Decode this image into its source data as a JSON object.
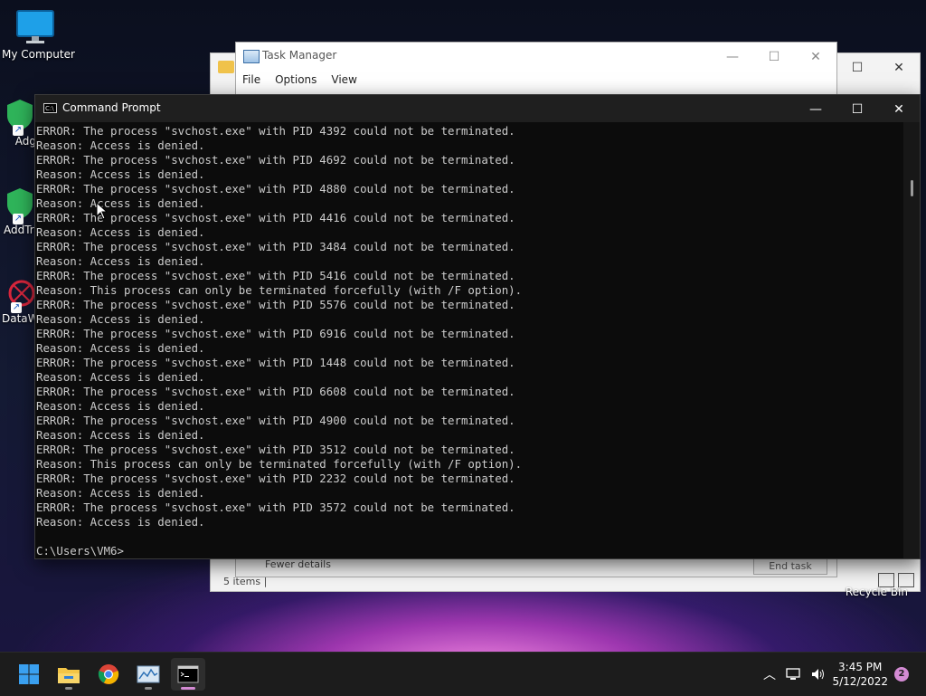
{
  "desktop": {
    "icons": [
      {
        "label": "My Computer"
      },
      {
        "label": "Adg"
      },
      {
        "label": "AddTri"
      },
      {
        "label": "DataW"
      }
    ],
    "recycle_bin": "Recycle Bin"
  },
  "explorer": {
    "status": "5 items  |"
  },
  "task_manager": {
    "title": "Task Manager",
    "menu": [
      "File",
      "Options",
      "View"
    ],
    "footer_left": "Fewer details",
    "footer_right": "End task"
  },
  "cmd": {
    "title": "Command Prompt",
    "lines": [
      "ERROR: The process \"svchost.exe\" with PID 4392 could not be terminated.",
      "Reason: Access is denied.",
      "ERROR: The process \"svchost.exe\" with PID 4692 could not be terminated.",
      "Reason: Access is denied.",
      "ERROR: The process \"svchost.exe\" with PID 4880 could not be terminated.",
      "Reason: Access is denied.",
      "ERROR: The process \"svchost.exe\" with PID 4416 could not be terminated.",
      "Reason: Access is denied.",
      "ERROR: The process \"svchost.exe\" with PID 3484 could not be terminated.",
      "Reason: Access is denied.",
      "ERROR: The process \"svchost.exe\" with PID 5416 could not be terminated.",
      "Reason: This process can only be terminated forcefully (with /F option).",
      "ERROR: The process \"svchost.exe\" with PID 5576 could not be terminated.",
      "Reason: Access is denied.",
      "ERROR: The process \"svchost.exe\" with PID 6916 could not be terminated.",
      "Reason: Access is denied.",
      "ERROR: The process \"svchost.exe\" with PID 1448 could not be terminated.",
      "Reason: Access is denied.",
      "ERROR: The process \"svchost.exe\" with PID 6608 could not be terminated.",
      "Reason: Access is denied.",
      "ERROR: The process \"svchost.exe\" with PID 4900 could not be terminated.",
      "Reason: Access is denied.",
      "ERROR: The process \"svchost.exe\" with PID 3512 could not be terminated.",
      "Reason: This process can only be terminated forcefully (with /F option).",
      "ERROR: The process \"svchost.exe\" with PID 2232 could not be terminated.",
      "Reason: Access is denied.",
      "ERROR: The process \"svchost.exe\" with PID 3572 could not be terminated.",
      "Reason: Access is denied.",
      "",
      "C:\\Users\\VM6>"
    ]
  },
  "taskbar": {
    "apps": [
      "start-icon",
      "file-explorer-icon",
      "chrome-icon",
      "task-manager-icon",
      "command-prompt-icon"
    ],
    "time": "3:45 PM",
    "date": "5/12/2022",
    "notification_count": "2"
  },
  "colors": {
    "console_bg": "#0c0c0c",
    "console_text": "#cccccc",
    "taskbar_bg": "#1c1c1c",
    "accent": "#d48bd4"
  }
}
